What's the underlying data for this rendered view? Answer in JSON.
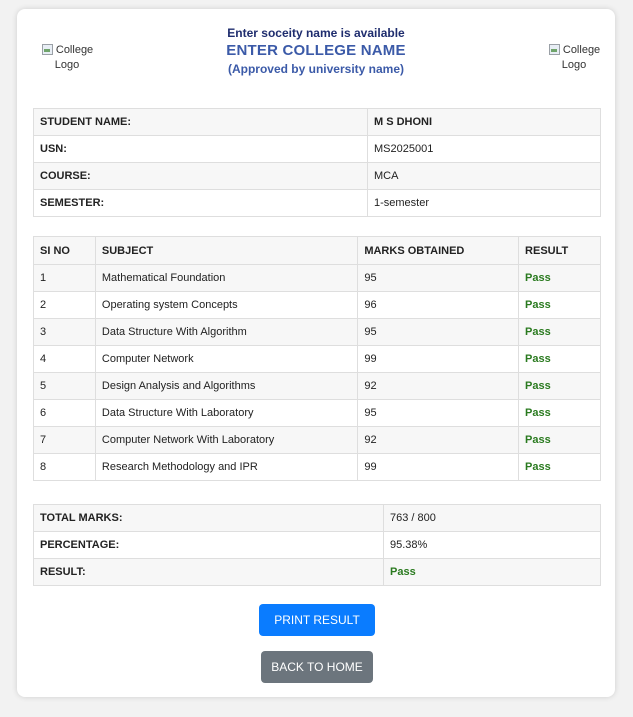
{
  "header": {
    "left_logo_alt": "College Logo",
    "right_logo_alt": "College Logo",
    "society_name": "Enter soceity name is available",
    "college_name": "ENTER COLLEGE NAME",
    "approved_text": "(Approved by university name)"
  },
  "student": [
    {
      "label": "STUDENT NAME:",
      "value": "M S DHONI"
    },
    {
      "label": "USN:",
      "value": "MS2025001"
    },
    {
      "label": "COURSE:",
      "value": "MCA"
    },
    {
      "label": "SEMESTER:",
      "value": "1-semester"
    }
  ],
  "marks_table": {
    "headers": [
      "SI NO",
      "SUBJECT",
      "MARKS OBTAINED",
      "RESULT"
    ],
    "rows": [
      {
        "si": "1",
        "subject": "Mathematical Foundation",
        "marks": "95",
        "result": "Pass"
      },
      {
        "si": "2",
        "subject": "Operating system Concepts",
        "marks": "96",
        "result": "Pass"
      },
      {
        "si": "3",
        "subject": "Data Structure With Algorithm",
        "marks": "95",
        "result": "Pass"
      },
      {
        "si": "4",
        "subject": "Computer Network",
        "marks": "99",
        "result": "Pass"
      },
      {
        "si": "5",
        "subject": "Design Analysis and Algorithms",
        "marks": "92",
        "result": "Pass"
      },
      {
        "si": "6",
        "subject": "Data Structure With Laboratory",
        "marks": "95",
        "result": "Pass"
      },
      {
        "si": "7",
        "subject": "Computer Network With Laboratory",
        "marks": "92",
        "result": "Pass"
      },
      {
        "si": "8",
        "subject": "Research Methodology and IPR",
        "marks": "99",
        "result": "Pass"
      }
    ]
  },
  "summary": {
    "total_label": "TOTAL MARKS:",
    "total_value": "763 / 800",
    "percentage_label": "PERCENTAGE:",
    "percentage_value": "95.38%",
    "result_label": "RESULT:",
    "result_value": "Pass"
  },
  "buttons": {
    "print_label": "PRINT RESULT",
    "home_label": "BACK TO HOME"
  },
  "colors": {
    "pass": "#2a7a1f",
    "primary_button": "#0a7cff",
    "secondary_button": "#6c757d",
    "title": "#3b5aa8"
  }
}
